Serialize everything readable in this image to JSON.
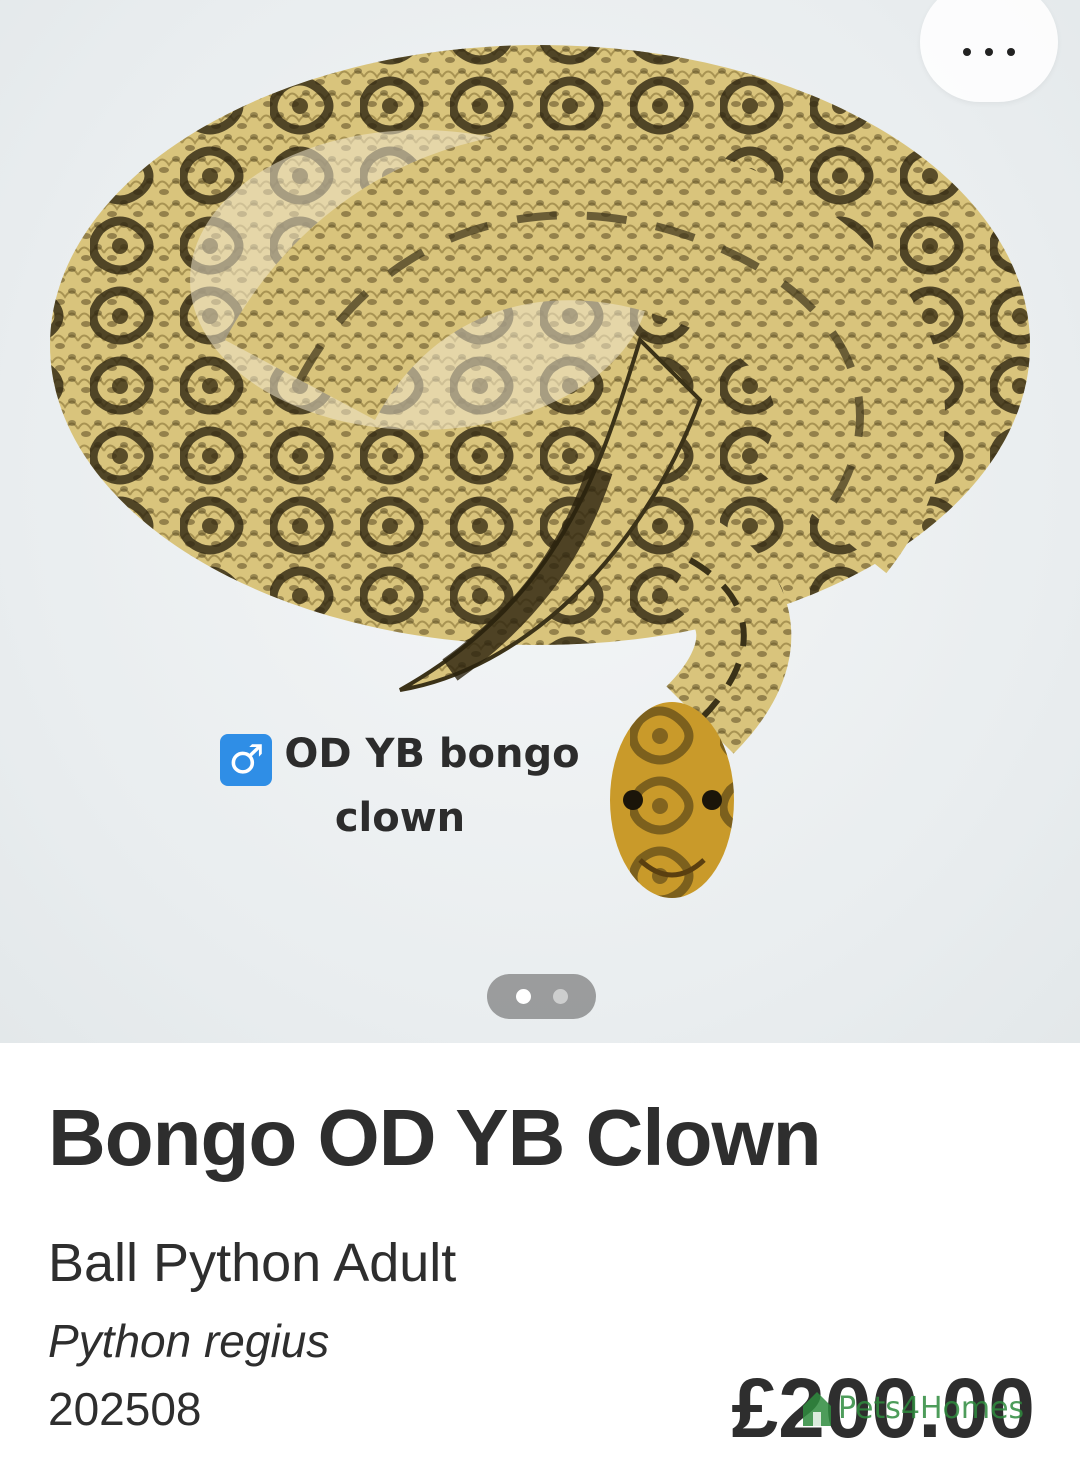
{
  "hero": {
    "caption_symbol": "♂",
    "caption": "OD YB bongo clown",
    "menu_icon": "more-horizontal-icon",
    "pager": {
      "count": 2,
      "active_index": 0
    }
  },
  "listing": {
    "title": "Bongo OD YB Clown",
    "subtitle": "Ball Python Adult",
    "species": "Python regius",
    "reference": "202508",
    "price": "£200.00"
  },
  "watermark": {
    "text": "Pets4Homes"
  },
  "colors": {
    "snake_base": "#d7c27a",
    "snake_dark": "#3b3218",
    "watermark_green": "#2e8b3e",
    "badge_blue": "#2f8ee6"
  }
}
